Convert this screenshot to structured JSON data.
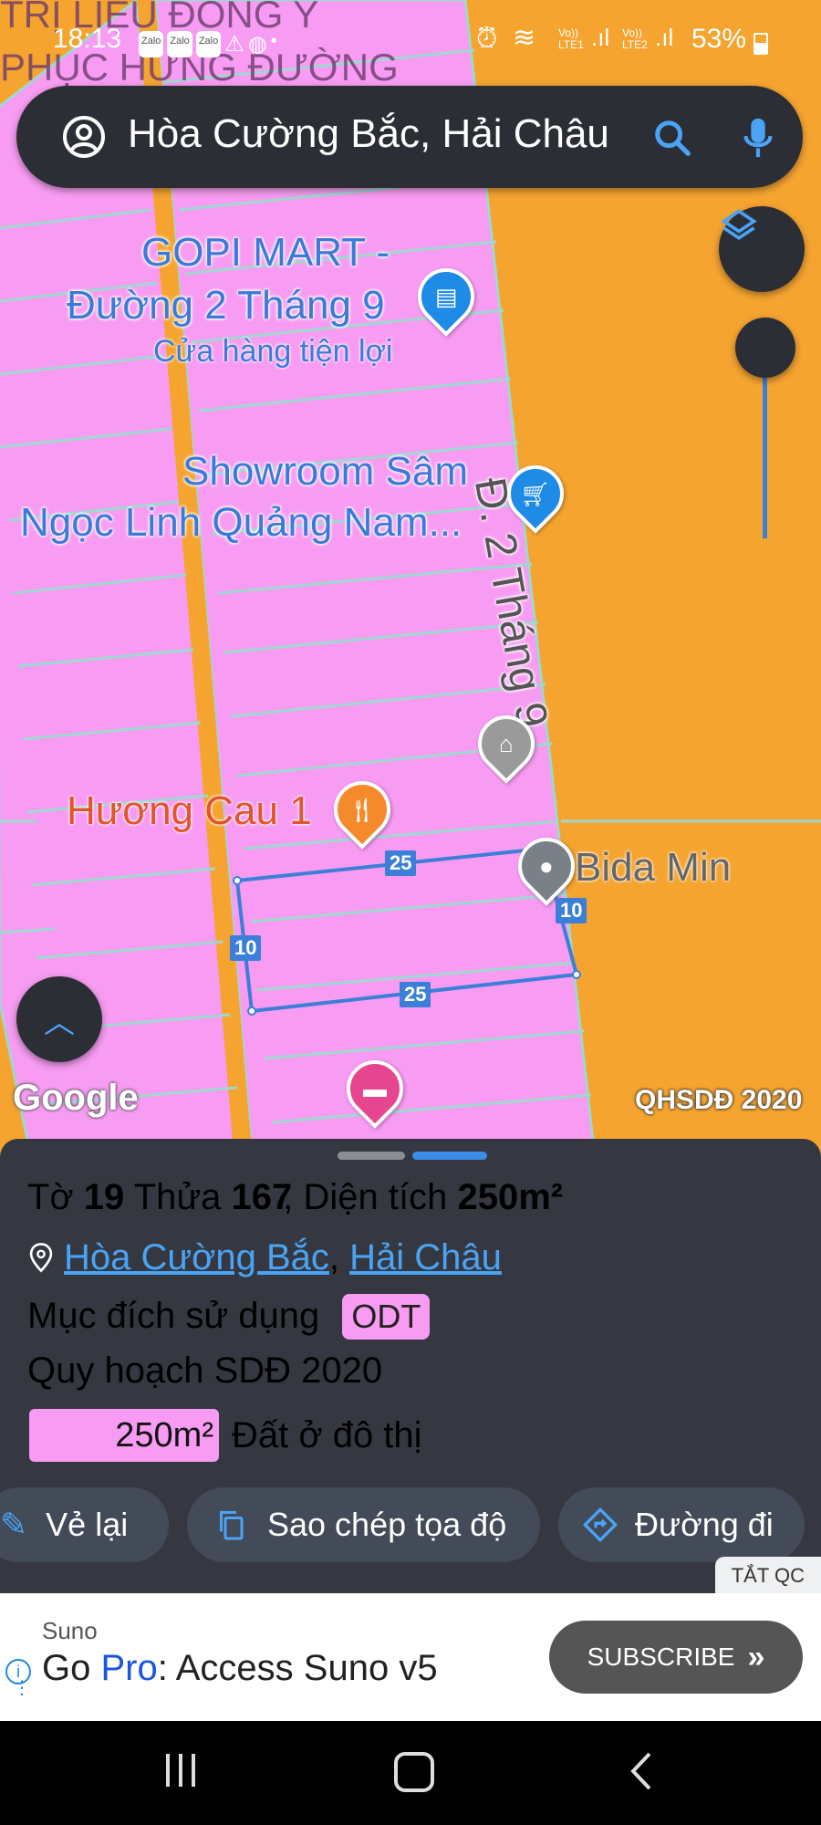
{
  "status_bar": {
    "time": "18:13",
    "app_icons": [
      "Zalo",
      "Zalo",
      "Zalo"
    ],
    "battery": "53%",
    "sim1": "LTE1",
    "sim2": "LTE2",
    "volte": "Vo))"
  },
  "map_overlay_title": [
    "TRỊ LIỆU ĐÔNG Y",
    "PHỤC HƯNG ĐƯỜNG"
  ],
  "search": {
    "value": "Hòa Cường Bắc, Hải Châu"
  },
  "map": {
    "poi_gopi_lines": [
      "GOPI MART -",
      "Đường 2 Tháng 9"
    ],
    "poi_gopi_sub": "Cửa hàng tiện lợi",
    "poi_showroom_lines": [
      "Showroom Sâm",
      "Ngọc Linh Quảng Nam..."
    ],
    "street_label": "Đ. 2 Tháng 9",
    "poi_restaurant": "Hương Cau 1",
    "poi_bida": "Bida Min",
    "dims": {
      "top": "25",
      "bottom": "25",
      "left": "10",
      "right": "10"
    },
    "attribution": "Google",
    "layer_label": "QHSDĐ 2020"
  },
  "parcel": {
    "to_label": "Tờ",
    "to_value": "19",
    "thua_label": "Thửa",
    "thua_value": "167",
    "area_label": "Diện tích",
    "area_value": "250m²",
    "ward": "Hòa Cường Bắc",
    "district": "Hải Châu",
    "purpose_label": "Mục đích sử dụng",
    "purpose_code": "ODT",
    "plan_label": "Quy hoạch SDĐ 2020",
    "legend_area": "250m²",
    "legend_desc": "Đất ở đô thị",
    "legend_color": "#f79cf2"
  },
  "actions": {
    "redraw": "Vẻ lại",
    "copy_coords": "Sao chép tọa độ",
    "directions": "Đường đi",
    "hide_ads": "TẮT QC"
  },
  "ad": {
    "advertiser": "Suno",
    "headline_part1": "Go ",
    "headline_part2": "Pro",
    "headline_part3": ": Access Suno v5",
    "cta": "SUBSCRIBE"
  },
  "colors": {
    "map_orange": "#f5a430",
    "zone_pink": "#f79cf2",
    "parcel_blue": "#3b7fd8",
    "panel_bg": "#353840"
  }
}
